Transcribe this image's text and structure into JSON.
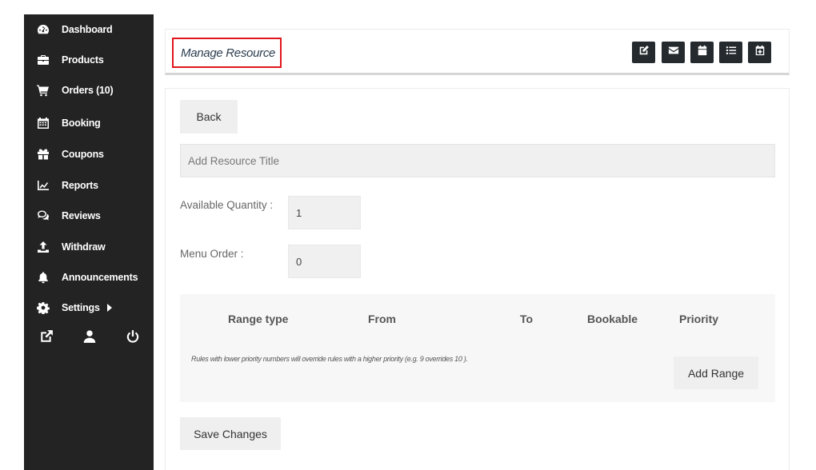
{
  "sidebar": {
    "items": [
      {
        "label": "Dashboard",
        "icon": "dashboard-icon"
      },
      {
        "label": "Products",
        "icon": "briefcase-icon"
      },
      {
        "label": "Orders (10)",
        "icon": "cart-icon"
      },
      {
        "label": "Booking",
        "icon": "calendar-icon"
      },
      {
        "label": "Coupons",
        "icon": "gift-icon"
      },
      {
        "label": "Reports",
        "icon": "chart-icon"
      },
      {
        "label": "Reviews",
        "icon": "comments-icon"
      },
      {
        "label": "Withdraw",
        "icon": "upload-icon"
      },
      {
        "label": "Announcements",
        "icon": "bell-icon"
      },
      {
        "label": "Settings",
        "icon": "gear-icon"
      }
    ],
    "bottom_icons": [
      "external-link-icon",
      "user-icon",
      "power-icon"
    ]
  },
  "header": {
    "title": "Manage Resource",
    "tools": [
      "edit-icon",
      "envelope-icon",
      "calendar-icon",
      "list-icon",
      "calendar-plus-icon"
    ]
  },
  "form": {
    "back_label": "Back",
    "title_placeholder": "Add Resource Title",
    "quantity_label": "Available Quantity :",
    "quantity_value": "1",
    "menu_order_label": "Menu Order :",
    "menu_order_value": "0",
    "range_table": {
      "columns": [
        "Range type",
        "From",
        "To",
        "Bookable",
        "Priority"
      ],
      "note": "Rules with lower priority numbers will override rules with a higher priority (e.g. 9 overrides 10 ).",
      "add_range_label": "Add Range"
    },
    "save_label": "Save Changes"
  }
}
